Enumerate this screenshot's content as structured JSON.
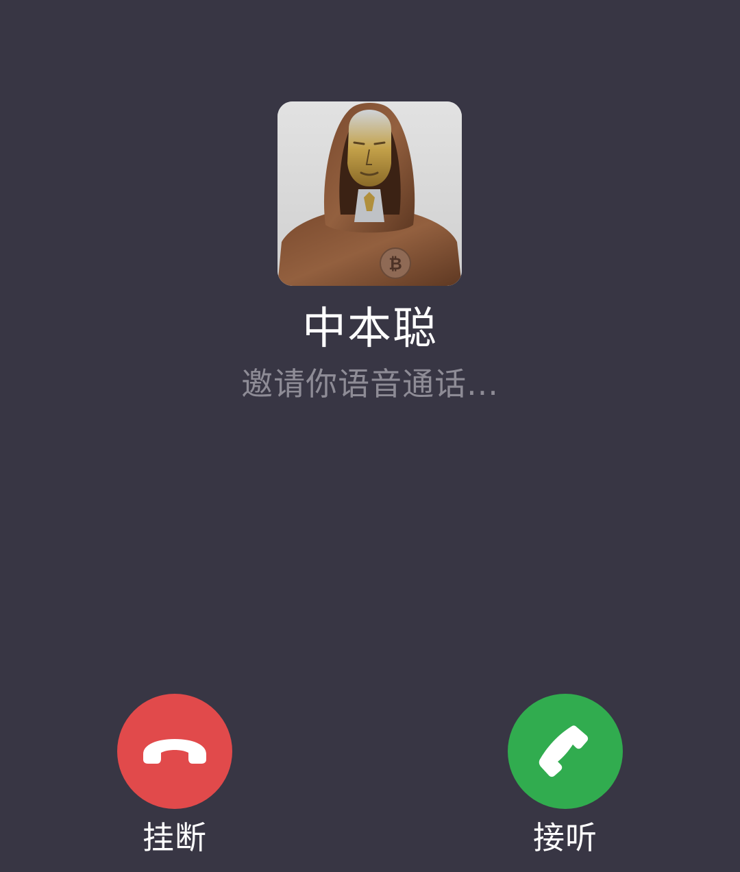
{
  "caller": {
    "name": "中本聪",
    "status": "邀请你语音通话..."
  },
  "avatar": {
    "icon": "hooded-figure-avatar"
  },
  "actions": {
    "hangup": {
      "label": "挂断",
      "icon": "phone-hangup-icon",
      "color": "#e14a4b"
    },
    "answer": {
      "label": "接听",
      "icon": "phone-answer-icon",
      "color": "#31ac4f"
    }
  },
  "theme": {
    "background": "#383644",
    "name_color": "#ffffff",
    "status_color": "#8e8c96"
  }
}
